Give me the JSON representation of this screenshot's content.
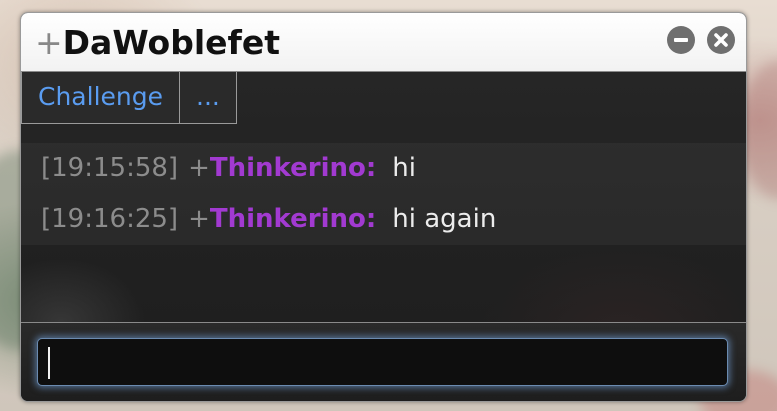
{
  "window": {
    "title_rank": "+",
    "title_name": "DaWoblefet",
    "minimize_icon": "minus-circle-icon",
    "close_icon": "x-circle-icon"
  },
  "actions": {
    "challenge_label": "Challenge",
    "more_label": "..."
  },
  "messages": [
    {
      "time": "[19:15:58]",
      "rank": "+",
      "user": "Thinkerino:",
      "text": "hi"
    },
    {
      "time": "[19:16:25]",
      "rank": "+",
      "user": "Thinkerino:",
      "text": "hi again"
    }
  ],
  "composer": {
    "value": "",
    "placeholder": ""
  },
  "colors": {
    "username": "#a23ad1",
    "link": "#5a9cf0",
    "timestamp": "#8c8c8c",
    "focus_glow": "#78aae6"
  }
}
